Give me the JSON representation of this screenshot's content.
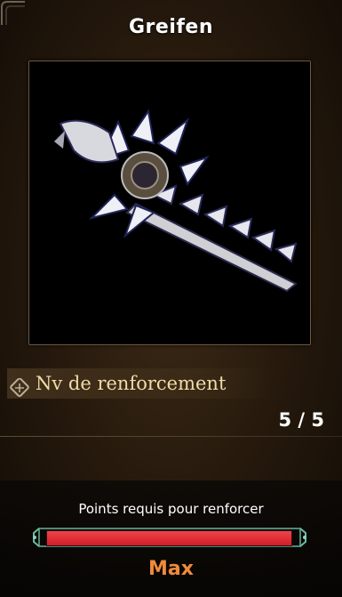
{
  "title": "Greifen",
  "preview": {
    "icon": "weapon-icon"
  },
  "stat": {
    "icon": "reinforce-icon",
    "label": "Nv de renforcement",
    "value": "5 / 5"
  },
  "upgrade": {
    "label": "Points requis pour renforcer",
    "progress": 1.0,
    "status": "Max",
    "colors": {
      "bar": "#e02a33",
      "status": "#ef8a3c"
    }
  }
}
